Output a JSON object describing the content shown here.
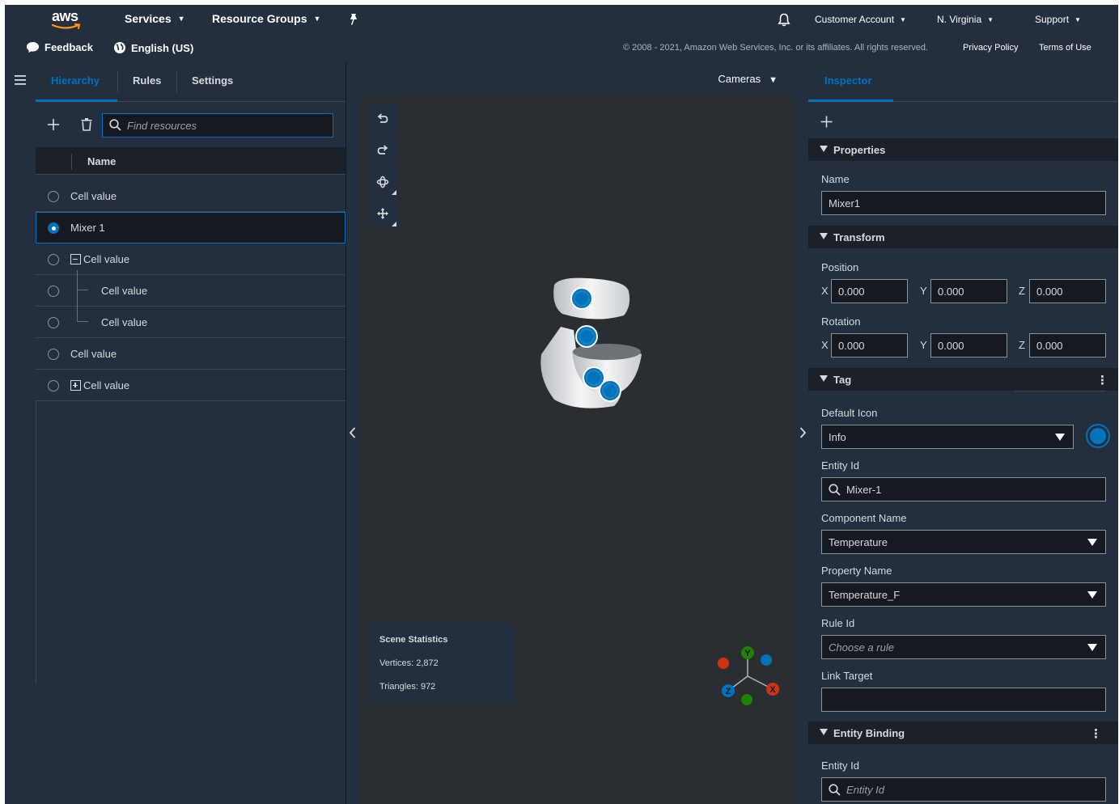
{
  "nav": {
    "logo_text": "aws",
    "services_label": "Services",
    "resource_groups_label": "Resource Groups",
    "account_label": "Customer Account",
    "region_label": "N. Virginia",
    "support_label": "Support",
    "feedback_label": "Feedback",
    "language_label": "English (US)",
    "copyright": "© 2008 - 2021, Amazon Web Services, Inc. or its affiliates. All rights reserved.",
    "privacy_label": "Privacy Policy",
    "terms_label": "Terms of Use"
  },
  "left_panel": {
    "tabs": [
      "Hierarchy",
      "Rules",
      "Settings"
    ],
    "active_tab": "Hierarchy",
    "search_placeholder": "Find resources",
    "column_header": "Name",
    "rows": [
      {
        "label": "Cell value",
        "selected": false,
        "level": 0,
        "toggle": null
      },
      {
        "label": "Mixer 1",
        "selected": true,
        "level": 0,
        "toggle": null
      },
      {
        "label": "Cell value",
        "selected": false,
        "level": 0,
        "toggle": "collapse"
      },
      {
        "label": "Cell value",
        "selected": false,
        "level": 1,
        "toggle": null
      },
      {
        "label": "Cell value",
        "selected": false,
        "level": 1,
        "toggle": null
      },
      {
        "label": "Cell value",
        "selected": false,
        "level": 0,
        "toggle": null
      },
      {
        "label": "Cell value",
        "selected": false,
        "level": 0,
        "toggle": "expand"
      }
    ]
  },
  "viewport": {
    "cameras_label": "Cameras",
    "stats": {
      "title": "Scene Statistics",
      "vertices": "Vertices: 2,872",
      "triangles": "Triangles: 972"
    },
    "gizmo_axes": {
      "x": "X",
      "y": "Y",
      "z": "Z"
    }
  },
  "inspector": {
    "tab": "Inspector",
    "sections": {
      "properties": "Properties",
      "transform": "Transform",
      "tag": "Tag",
      "entity_binding": "Entity Binding"
    },
    "name_label": "Name",
    "name_value": "Mixer1",
    "position_label": "Position",
    "rotation_label": "Rotation",
    "axis_labels": [
      "X",
      "Y",
      "Z"
    ],
    "position": [
      "0.000",
      "0.000",
      "0.000"
    ],
    "rotation": [
      "0.000",
      "0.000",
      "0.000"
    ],
    "default_icon_label": "Default Icon",
    "default_icon_value": "Info",
    "entity_id_label": "Entity Id",
    "entity_id_value": "Mixer-1",
    "component_name_label": "Component Name",
    "component_name_value": "Temperature",
    "property_name_label": "Property Name",
    "property_name_value": "Temperature_F",
    "rule_id_label": "Rule Id",
    "rule_id_placeholder": "Choose a rule",
    "link_target_label": "Link Target",
    "link_target_value": "",
    "binding_entity_id_label": "Entity Id",
    "binding_entity_id_placeholder": "Entity Id"
  },
  "colors": {
    "accent": "#0073bb",
    "nav_bg": "#232f3e",
    "panel_bg": "#232f3e",
    "viewport_bg": "#2a2e33",
    "axis_x": "#d13212",
    "axis_y": "#1d8102",
    "axis_z": "#0073bb"
  },
  "icons": {
    "favorite": "pin-icon",
    "notifications": "bell-icon",
    "menu": "hamburger-icon",
    "add": "plus-icon",
    "delete": "trash-icon",
    "search": "search-icon",
    "undo": "undo-icon",
    "redo": "redo-icon",
    "translate": "move-icon",
    "rotate": "rotate-icon"
  }
}
